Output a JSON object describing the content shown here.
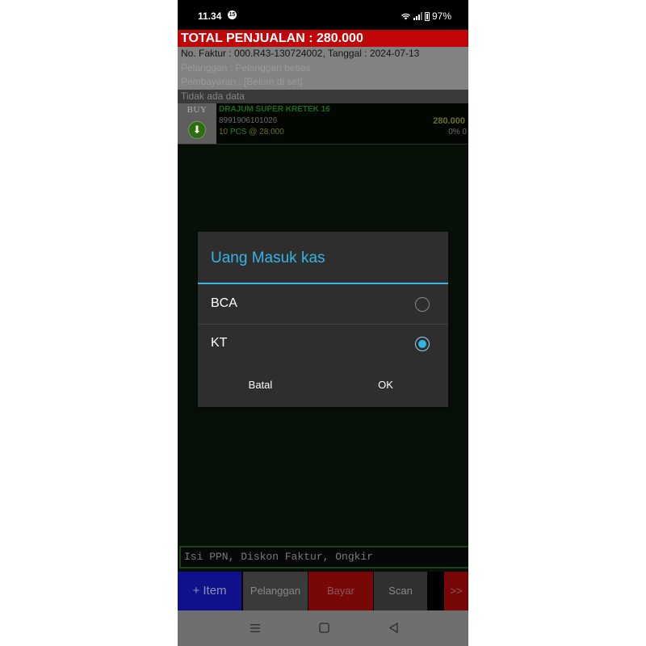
{
  "status_bar": {
    "time": "11.34",
    "notification": "15",
    "battery": "97%"
  },
  "header": {
    "total": "TOTAL PENJUALAN : 280.000",
    "invoice": "No. Faktur : 000.R43-130724002, Tanggal : 2024-07-13",
    "customer": "Pelanggan : Pelanggan bebas",
    "payment": "Pembayaran : [Belum di set]"
  },
  "list": {
    "empty_text": "Tidak ada data",
    "items": [
      {
        "type_label": "BUY",
        "name": "DRAJUM SUPER KRETEK 16",
        "code": "8991906101026",
        "qty": "10",
        "unit": "PCS",
        "unit_price": "@ 28.000",
        "total": "280.000",
        "discount": "0%  0"
      }
    ]
  },
  "extras_field": "Isi PPN, Diskon Faktur, Ongkir",
  "bottom_bar": {
    "item": "+ Item",
    "customer": "Pelanggan",
    "pay": "Bayar",
    "scan": "Scan",
    "more": ">>"
  },
  "dialog": {
    "title": "Uang Masuk kas",
    "options": [
      {
        "label": "BCA",
        "selected": false
      },
      {
        "label": "KT",
        "selected": true
      }
    ],
    "cancel": "Batal",
    "ok": "OK"
  },
  "nav": {
    "recents_icon": "menu-icon",
    "home_icon": "square-icon",
    "back_icon": "triangle-back-icon"
  },
  "colors": {
    "accent": "#33b5e5",
    "total_bar": "#c1060a",
    "item_button": "#10118a",
    "pay_button": "#780808"
  }
}
